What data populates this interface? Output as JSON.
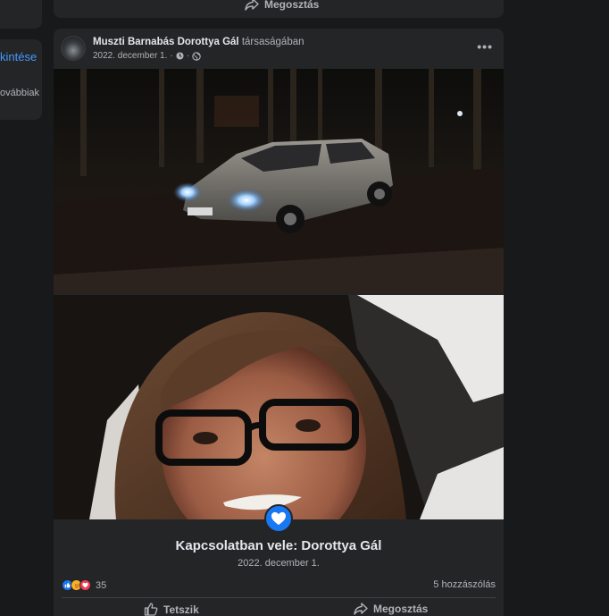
{
  "left_sidebar": {
    "link_label": "kintése",
    "more_label": "ovábbiak"
  },
  "previous_post": {
    "share_label": "Megosztás"
  },
  "post": {
    "author": "Muszti Barnabás",
    "second_person": "Dorottya Gál",
    "with_text": "társaságában",
    "date": "2022. december 1.",
    "privacy_icon": "globe-icon",
    "life_event_icon": "heart-icon",
    "life_event_title": "Kapcsolatban vele: Dorottya Gál",
    "life_event_date": "2022. december 1.",
    "reactions": [
      "like",
      "care",
      "love"
    ],
    "reaction_count": "35",
    "comments_count": "5 hozzászólás",
    "actions": {
      "like_label": "Tetszik",
      "share_label": "Megosztás"
    }
  },
  "colors": {
    "background": "#18191a",
    "card": "#242526",
    "accent": "#1877f2",
    "text_primary": "#e4e6eb",
    "text_secondary": "#b0b3b8",
    "link": "#4599ff"
  }
}
